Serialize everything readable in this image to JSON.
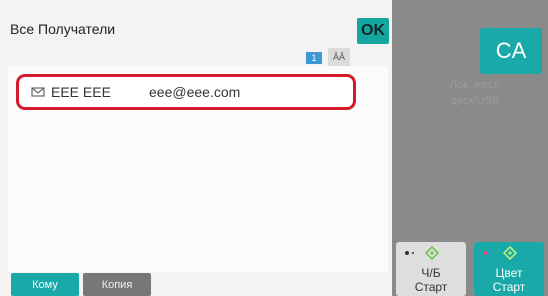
{
  "header": {
    "title": "Все Получатели",
    "ok_label": "OK"
  },
  "list_tools": {
    "page_number": "1",
    "sort_label": "ĀĀ"
  },
  "recipients": [
    {
      "name": "EEE EEE",
      "email": "eee@eee.com",
      "icon": "mail-icon"
    }
  ],
  "tabs": [
    {
      "label": "Кому",
      "active": true
    },
    {
      "label": "Копия",
      "active": false
    }
  ],
  "side": {
    "ca_label": "CA",
    "ghost_label": "Лок. жест. диск/USB"
  },
  "start_buttons": {
    "bw": {
      "line1": "Ч/Б",
      "line2": "Старт"
    },
    "color": {
      "line1": "Цвет",
      "line2": "Старт"
    }
  },
  "colors": {
    "accent": "#1aa9a9",
    "highlight": "#d31b2b",
    "page_indicator": "#3d98d6"
  }
}
